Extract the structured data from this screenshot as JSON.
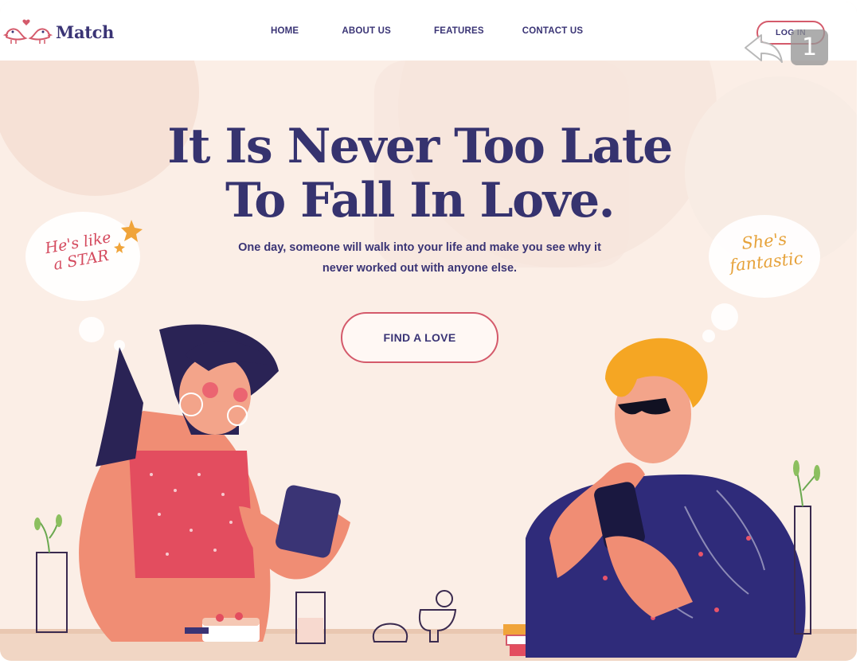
{
  "brand": {
    "name": "Match"
  },
  "nav": {
    "items": [
      "HOME",
      "ABOUT US",
      "FEATURES",
      "CONTACT US"
    ]
  },
  "header": {
    "login_label": "LOG IN"
  },
  "overlay": {
    "badge_count": "1",
    "back_icon": "back-arrow-icon"
  },
  "hero": {
    "title_line1": "It Is Never Too Late",
    "title_line2": "To Fall In Love.",
    "subtitle_line1": "One day, someone will walk into your life and make you see why it",
    "subtitle_line2": "never worked out with anyone else.",
    "cta_label": "FIND A LOVE",
    "bubble_left_line1": "He's like",
    "bubble_left_line2": "a STAR",
    "bubble_right_line1": "She's",
    "bubble_right_line2": "fantastic"
  },
  "colors": {
    "brand_navy": "#3a3475",
    "accent_pink": "#d45a6b",
    "background": "#fbeee6"
  }
}
